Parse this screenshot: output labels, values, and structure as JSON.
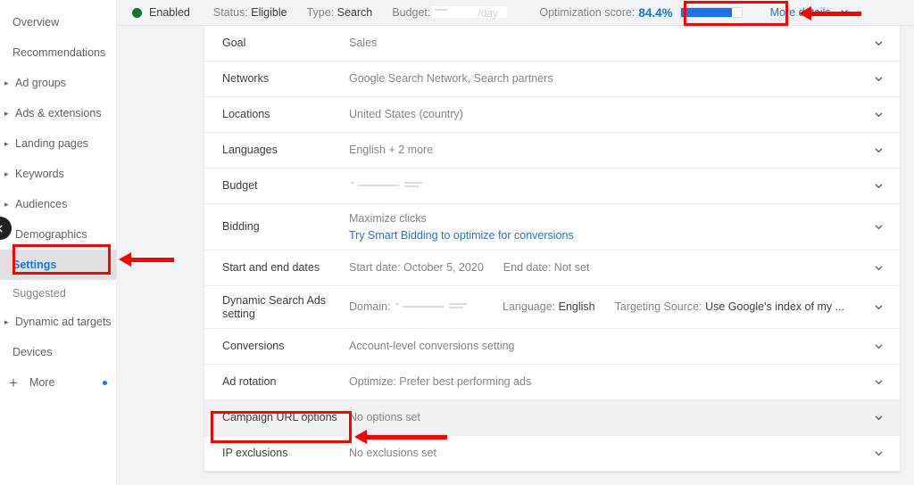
{
  "topbar": {
    "status_label": "Enabled",
    "status_dot_color": "#137333",
    "status_field_label": "Status:",
    "status_field_value": "Eligible",
    "type_field_label": "Type:",
    "type_field_value": "Search",
    "budget_field_label": "Budget:",
    "budget_field_value": "/day",
    "optimization_label": "Optimization score:",
    "optimization_value": "84.4%",
    "optimization_percent": 84.4,
    "optimization_color": "#1a73e8",
    "more_details_label": "More details",
    "more_details_chevron": "chevron-down-icon"
  },
  "sidebar": {
    "items": [
      {
        "label": "Overview",
        "expandable": false,
        "selected": false
      },
      {
        "label": "Recommendations",
        "expandable": false,
        "selected": false
      },
      {
        "label": "Ad groups",
        "expandable": true,
        "selected": false
      },
      {
        "label": "Ads & extensions",
        "expandable": true,
        "selected": false
      },
      {
        "label": "Landing pages",
        "expandable": true,
        "selected": false
      },
      {
        "label": "Keywords",
        "expandable": true,
        "selected": false
      },
      {
        "label": "Audiences",
        "expandable": true,
        "selected": false
      },
      {
        "label": "Demographics",
        "expandable": true,
        "selected": false
      },
      {
        "label": "Settings",
        "expandable": false,
        "selected": true
      }
    ],
    "section_label": "Suggested",
    "suggested_items": [
      {
        "label": "Dynamic ad targets",
        "expandable": true
      },
      {
        "label": "Devices",
        "expandable": false
      }
    ],
    "more_label": "More",
    "more_icon": "plus-icon",
    "more_badge_color": "#1a73e8",
    "collapse_icon": "chevron-left-icon"
  },
  "settings": {
    "rows": [
      {
        "label": "Goal",
        "value": "Sales",
        "type": "simple",
        "highlighted": false
      },
      {
        "label": "Networks",
        "value": "Google Search Network, Search partners",
        "type": "simple",
        "highlighted": false
      },
      {
        "label": "Locations",
        "value": "United States (country)",
        "type": "simple",
        "highlighted": false
      },
      {
        "label": "Languages",
        "value": "English + 2 more",
        "type": "simple",
        "highlighted": false
      },
      {
        "label": "Budget",
        "value": "",
        "type": "redacted",
        "highlighted": false
      },
      {
        "label": "Bidding",
        "value": "Maximize clicks",
        "link": "Try Smart Bidding to optimize for conversions",
        "type": "two-line",
        "highlighted": false
      },
      {
        "label": "Start and end dates",
        "value": "Start date: October 5, 2020",
        "value2": "End date: Not set",
        "type": "two-part",
        "highlighted": false
      },
      {
        "label": "Dynamic Search Ads setting",
        "value": "",
        "type": "dsa",
        "domain_label": "Domain:",
        "language_label": "Language:",
        "language_value": "English",
        "targeting_label": "Targeting Source:",
        "targeting_value": "Use Google's index of my ...",
        "highlighted": false
      },
      {
        "label": "Conversions",
        "value": "Account-level conversions setting",
        "type": "simple",
        "highlighted": false
      },
      {
        "label": "Ad rotation",
        "value": "Optimize: Prefer best performing ads",
        "type": "simple",
        "highlighted": false
      },
      {
        "label": "Campaign URL options",
        "value": "No options set",
        "type": "simple",
        "highlighted": true
      },
      {
        "label": "IP exclusions",
        "value": "No exclusions set",
        "type": "simple",
        "highlighted": false
      }
    ],
    "row_chevron": "chevron-down-icon"
  },
  "annotations": {
    "color": "#ff0000",
    "boxes": [
      {
        "target": "more-details-button"
      },
      {
        "target": "sidebar-item-settings"
      },
      {
        "target": "campaign-url-options-label"
      }
    ],
    "arrows": [
      {
        "target": "more-details-button",
        "direction": "left"
      },
      {
        "target": "sidebar-item-settings",
        "direction": "left"
      },
      {
        "target": "campaign-url-options-label",
        "direction": "left"
      }
    ]
  }
}
